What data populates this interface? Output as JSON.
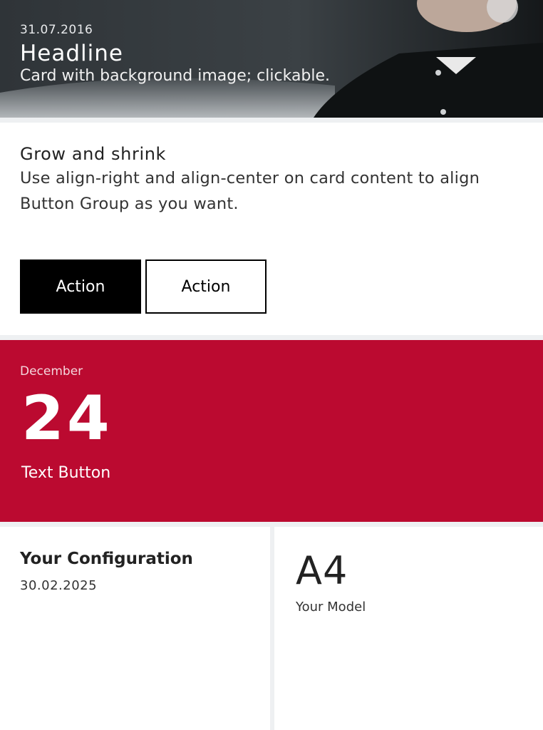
{
  "image_card": {
    "date": "31.07.2016",
    "headline": "Headline",
    "subtitle": "Card with background image; clickable."
  },
  "grow_card": {
    "title": "Grow and shrink",
    "description": "Use align-right and align-center on card content to align Button Group as you want.",
    "primary_action": "Action",
    "secondary_action": "Action"
  },
  "date_card": {
    "month": "December",
    "day": "24",
    "text_button": "Text Button",
    "color": "#bb0a30"
  },
  "config_card": {
    "title": "Your Configuration",
    "date": "30.02.2025"
  },
  "model_card": {
    "model": "A4",
    "label": "Your Model"
  }
}
